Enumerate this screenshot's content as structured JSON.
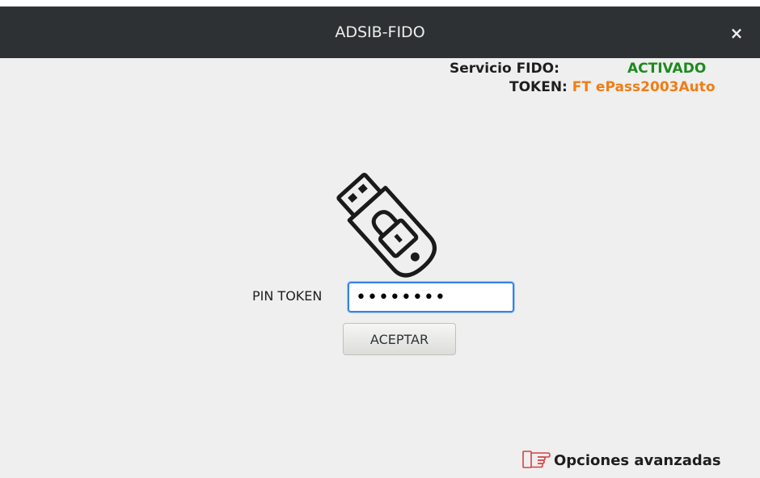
{
  "window": {
    "title": "ADSIB-FIDO",
    "close_label": "×"
  },
  "status": {
    "service_label": "Servicio FIDO:",
    "service_value": "ACTIVADO",
    "token_label": "TOKEN:",
    "token_value": "FT ePass2003Auto"
  },
  "form": {
    "pin_label": "PIN TOKEN",
    "pin_value": "••••••••",
    "accept_label": "ACEPTAR"
  },
  "footer": {
    "advanced_label": "Opciones avanzadas"
  },
  "icons": {
    "token": "usb-token-lock-icon",
    "advanced": "pointing-hand-icon"
  },
  "colors": {
    "titlebar": "#2d3133",
    "background": "#efefef",
    "active": "#1e8a1e",
    "token": "#f07d14",
    "focus": "#3584e4"
  }
}
